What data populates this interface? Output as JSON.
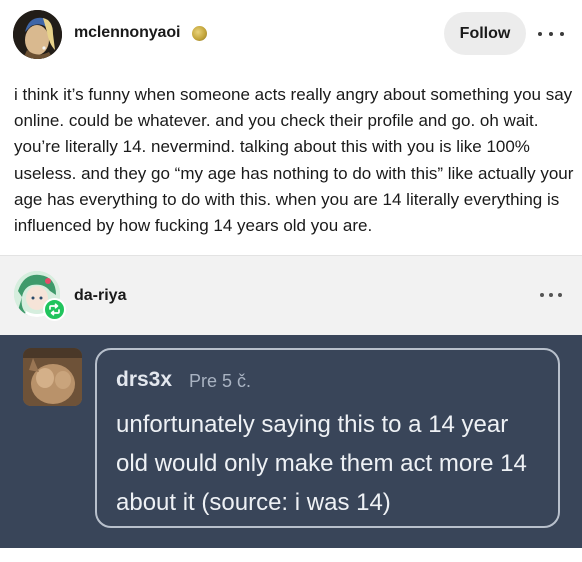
{
  "post": {
    "author": {
      "username": "mclennonyaoi",
      "avatar_icon": "pearl-earring-portrait",
      "badge_icon": "gold-coin-badge-icon"
    },
    "follow_label": "Follow",
    "more_icon": "ellipsis-icon",
    "body_text": "i think it’s funny when someone acts really angry about something you say online. could be whatever. and you check their profile and go. oh wait. you’re literally 14. nevermind. talking about this with you is like 100% useless. and they go “my age has nothing to do with this” like actually your age has everything to do with this. when you are 14 literally everything is influenced by how fucking 14 years old you are."
  },
  "reblog": {
    "username": "da-riya",
    "reblog_icon": "reblog-icon",
    "more_icon": "ellipsis-icon"
  },
  "comment": {
    "username": "drs3x",
    "timestamp": "Pre 5 č.",
    "text": "unfortunately saying this to a 14 year old would only make them act more 14 about it (source: i was 14)"
  },
  "colors": {
    "comment_background": "#394559",
    "reblog_green": "#21c45d",
    "follow_button_bg": "#ececec"
  }
}
